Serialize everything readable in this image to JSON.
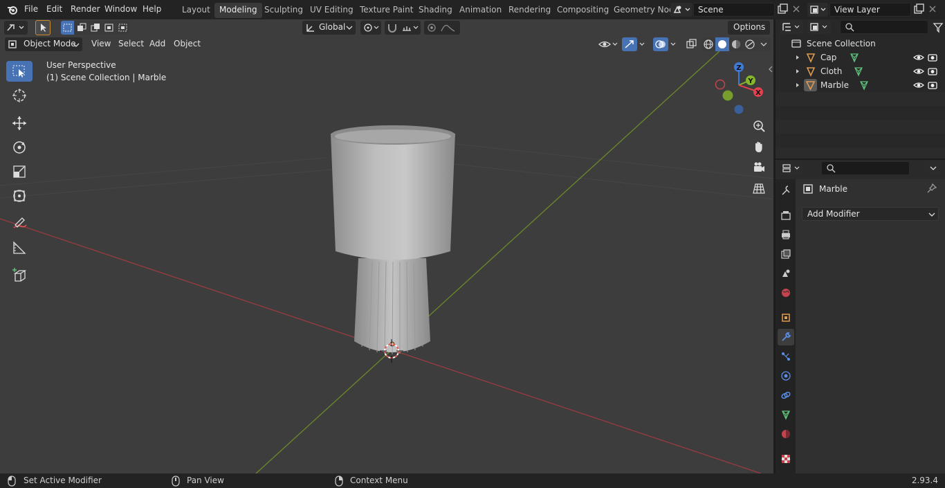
{
  "topbar": {
    "menus": [
      "File",
      "Edit",
      "Render",
      "Window",
      "Help"
    ],
    "workspaces": [
      "Layout",
      "Modeling",
      "Sculpting",
      "UV Editing",
      "Texture Paint",
      "Shading",
      "Animation",
      "Rendering",
      "Compositing",
      "Geometry Nod"
    ],
    "active_workspace": "Modeling",
    "scene_name": "Scene",
    "view_layer": "View Layer"
  },
  "toolheader": {
    "transform_orientation": "Global",
    "options_label": "Options"
  },
  "viewport_header": {
    "mode": "Object Mode",
    "menus": [
      "View",
      "Select",
      "Add",
      "Object"
    ]
  },
  "viewport": {
    "perspective_label": "User Perspective",
    "context_label": "(1) Scene Collection | Marble",
    "gizmo_axes": [
      "X",
      "Y",
      "Z"
    ]
  },
  "outliner": {
    "root": "Scene Collection",
    "items": [
      {
        "name": "Cap"
      },
      {
        "name": "Cloth"
      },
      {
        "name": "Marble"
      }
    ]
  },
  "properties": {
    "object_name": "Marble",
    "add_modifier_label": "Add Modifier"
  },
  "statusbar": {
    "left_action": "Set Active Modifier",
    "middle_action": "Pan View",
    "right_action": "Context Menu",
    "version": "2.93.4"
  },
  "colors": {
    "accent": "#4772b3",
    "x_axis": "#e2414f",
    "y_axis": "#86b72a",
    "z_axis": "#3f7ad6",
    "object_orange": "#e09b4f",
    "mesh_green": "#5ec27a"
  }
}
